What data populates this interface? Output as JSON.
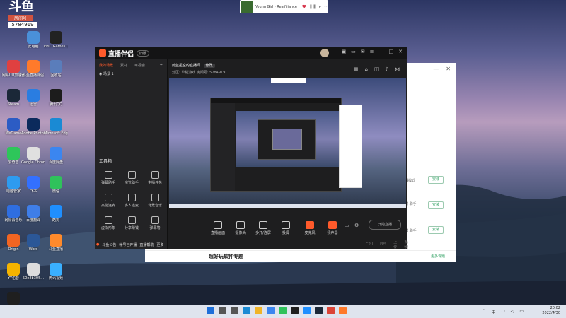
{
  "stream_overlay": {
    "logo": "斗鱼",
    "tag": "房间号",
    "room_id": "5784919"
  },
  "desktop_icons": [
    {
      "label": "此电脑",
      "color": "#4a90d9",
      "icon": "computer-icon"
    },
    {
      "label": "EPIC Games Launcher",
      "color": "#222222",
      "icon": "epic-icon"
    },
    {
      "label": "网易UU加速器",
      "color": "#e04040",
      "icon": "uu-icon"
    },
    {
      "label": "斗鱼直播伴侣",
      "color": "#ff7a2b",
      "icon": "douyu-icon"
    },
    {
      "label": "回收站",
      "color": "#5a7dbb",
      "icon": "recycle-bin-icon"
    },
    {
      "label": "Steam",
      "color": "#1b2838",
      "icon": "steam-icon"
    },
    {
      "label": "迅雷",
      "color": "#2a7de1",
      "icon": "xunlei-icon"
    },
    {
      "label": "腾讯QQ",
      "color": "#1c1c1c",
      "icon": "qq-icon"
    },
    {
      "label": "WeGame",
      "color": "#2c5cc4",
      "icon": "wegame-icon"
    },
    {
      "label": "Adobe Photoshop",
      "color": "#0b2a5c",
      "icon": "photoshop-icon"
    },
    {
      "label": "Microsoft Edge",
      "color": "#1a8ad4",
      "icon": "edge-icon"
    },
    {
      "label": "爱奇艺",
      "color": "#2ec65a",
      "icon": "iqiyi-icon"
    },
    {
      "label": "Google Chrome",
      "color": "#e0e0e0",
      "icon": "chrome-icon"
    },
    {
      "label": "百度网盘",
      "color": "#3b86f0",
      "icon": "baidu-netdisk-icon"
    },
    {
      "label": "电脑管家",
      "color": "#2e9bf0",
      "icon": "pc-manager-icon"
    },
    {
      "label": "飞书",
      "color": "#3370ff",
      "icon": "feishu-icon"
    },
    {
      "label": "微信",
      "color": "#2fc25b",
      "icon": "wechat-icon"
    },
    {
      "label": "网易云音乐",
      "color": "#2f6ee0",
      "icon": "cloudmusic-icon"
    },
    {
      "label": "百度翻译",
      "color": "#3f7ee8",
      "icon": "translate-icon"
    },
    {
      "label": "酷狗",
      "color": "#1f8fff",
      "icon": "kugou-icon"
    },
    {
      "label": "Origin",
      "color": "#f26522",
      "icon": "origin-icon"
    },
    {
      "label": "Word",
      "color": "#2b5797",
      "icon": "word-icon"
    },
    {
      "label": "斗鱼直播",
      "color": "#ff8a2b",
      "icon": "douyu-live-icon"
    },
    {
      "label": "YY语音",
      "color": "#f5b400",
      "icon": "yy-icon"
    },
    {
      "label": "50e8b305...",
      "color": "#dddddd",
      "icon": "file-icon"
    },
    {
      "label": "腾讯视频",
      "color": "#3ab0ff",
      "icon": "tencent-video-icon"
    },
    {
      "label": "Samsung Magician",
      "color": "#1f1f1f",
      "icon": "magician-icon"
    }
  ],
  "music_widget": {
    "title": "Young Girl - Realfiliance"
  },
  "bg_window": {
    "install_label": "安装",
    "row_texts": [
      "游戏模式",
      "系统 助手",
      "安装 助手"
    ],
    "footer_title": "超好玩软件专题",
    "footer_link": "更多专题"
  },
  "app": {
    "logo": "直播伴侣",
    "version": "旧版",
    "sidebar_tabs": [
      "我的场景",
      "素材",
      "可视窗"
    ],
    "scene_label": "场景 1",
    "tools_title": "工具箱",
    "tools": [
      "弹幕助手",
      "房管助手",
      "主播任务",
      "高能连麦",
      "多人连麦",
      "背景音乐",
      "虚拟形象",
      "分享赚钱",
      "弹幕墙"
    ],
    "bottom_status": [
      "斗鱼公告",
      "帐号已开播",
      "直播帮助",
      "更多"
    ],
    "room_title": "蔚蓝星空的直播间",
    "room_chip": "修改",
    "room_meta": "分区: 单机游戏   房间号: 5784919",
    "controls": [
      "直播画面",
      "摄像头",
      "多开/连屏",
      "投屏",
      "麦克风",
      "扬声器"
    ],
    "go_live_label": "开始直播",
    "status_stats": [
      "CPU",
      "FPS",
      "上传",
      "丢帧"
    ]
  },
  "taskbar": {
    "apps": [
      {
        "icon": "windows-start-icon",
        "color": "#1e6fd9"
      },
      {
        "icon": "search-icon",
        "color": "#555555"
      },
      {
        "icon": "task-view-icon",
        "color": "#555555"
      },
      {
        "icon": "edge-icon",
        "color": "#1a8ad4"
      },
      {
        "icon": "explorer-icon",
        "color": "#f0b429"
      },
      {
        "icon": "store-icon",
        "color": "#3b86f0"
      },
      {
        "icon": "douyu-icon",
        "color": "#2fc25b"
      },
      {
        "icon": "notion-icon",
        "color": "#1e1e1e"
      },
      {
        "icon": "kugou-icon",
        "color": "#1f8fff"
      },
      {
        "icon": "steam-icon",
        "color": "#1b2838"
      },
      {
        "icon": "chrome-icon",
        "color": "#db4437"
      },
      {
        "icon": "douyu-live-icon",
        "color": "#ff7a2b"
      }
    ],
    "ime": "中",
    "time": "20:02",
    "date": "2022/4/30"
  }
}
